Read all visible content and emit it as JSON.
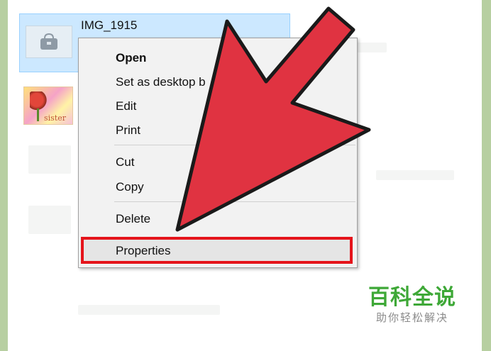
{
  "file": {
    "name": "IMG_1915"
  },
  "second_file": {
    "caption": "sister"
  },
  "context_menu": {
    "open": "Open",
    "set_as_desktop": "Set as desktop b",
    "edit": "Edit",
    "print": "Print",
    "cut": "Cut",
    "copy": "Copy",
    "delete": "Delete",
    "properties": "Properties"
  },
  "watermark": {
    "title": "百科全说",
    "subtitle": "助你轻松解决"
  },
  "colors": {
    "highlight_border": "#e5141b",
    "arrow_fill": "#e03341",
    "selection_bg": "#cce8ff",
    "logo_green": "#3ea837"
  },
  "icons": {
    "file_icon": "bag-image-icon",
    "pointer": "red-arrow-icon"
  }
}
